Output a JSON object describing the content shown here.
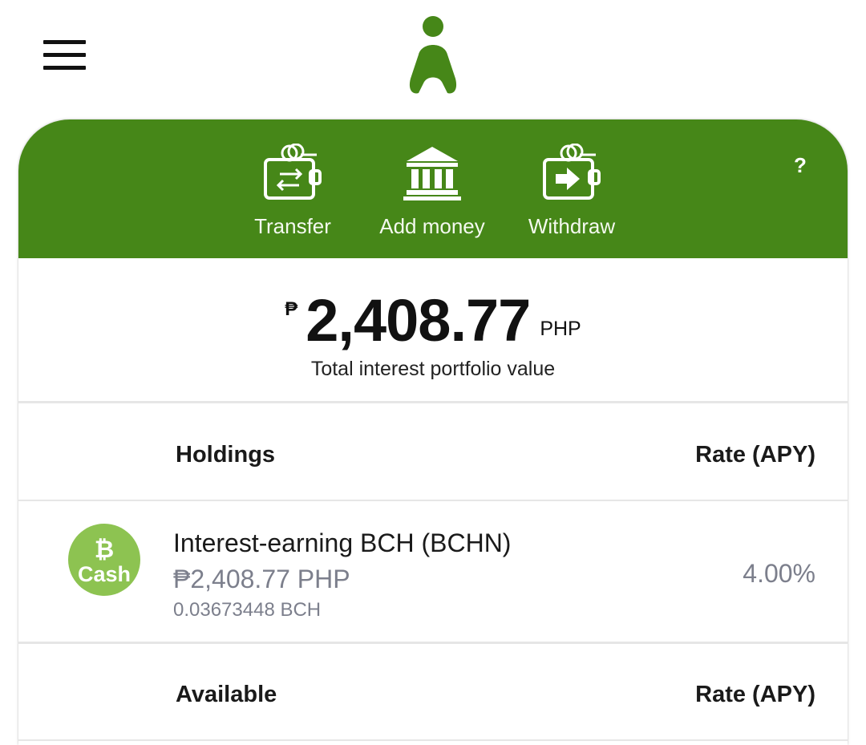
{
  "icons": {
    "menu": "hamburger-menu-icon",
    "logo": "app-logo",
    "transfer": "wallet-transfer-icon",
    "add_money": "bank-icon",
    "withdraw": "wallet-withdraw-icon",
    "coin": "bitcoin-cash-icon"
  },
  "colors": {
    "brand_green": "#468718",
    "coin_green": "#8dc351",
    "muted_text": "#7c7f8c"
  },
  "header": {
    "actions": [
      {
        "label": "Transfer"
      },
      {
        "label": "Add money"
      },
      {
        "label": "Withdraw"
      }
    ],
    "help_label": "?"
  },
  "portfolio": {
    "currency_symbol": "₱",
    "amount": "2,408.77",
    "currency_code": "PHP",
    "caption": "Total interest portfolio value"
  },
  "holdings_section": {
    "title": "Holdings",
    "rate_header": "Rate (APY)",
    "items": [
      {
        "coin_symbol": "₿",
        "coin_label": "Cash",
        "name": "Interest-earning BCH (BCHN)",
        "fiat_value": "₱2,408.77 PHP",
        "crypto_value": "0.03673448 BCH",
        "rate": "4.00%"
      }
    ]
  },
  "available_section": {
    "title": "Available",
    "rate_header": "Rate (APY)"
  }
}
